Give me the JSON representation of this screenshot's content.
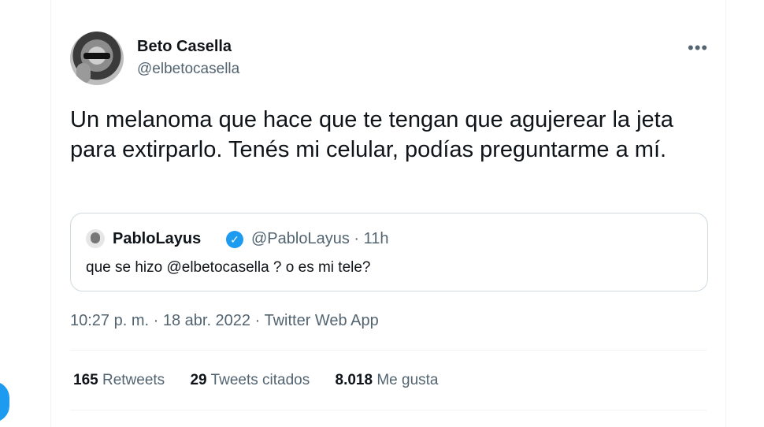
{
  "author": {
    "name": "Beto Casella",
    "handle": "@elbetocasella"
  },
  "tweet": {
    "text": "Un melanoma que hace que te tengan que agujerear la jeta para extirparlo. Tenés mi celular, podías preguntarme a mí.",
    "timestamp": "10:27 p. m. · 18 abr. 2022 · Twitter Web App"
  },
  "quoted": {
    "name": "PabloLayus",
    "meta": "@PabloLayus · 11h",
    "text": "que se hizo @elbetocasella ? o es mi tele?"
  },
  "stats": {
    "retweets_count": "165",
    "retweets_label": "Retweets",
    "quotes_count": "29",
    "quotes_label": "Tweets citados",
    "likes_count": "8.018",
    "likes_label": "Me gusta"
  },
  "icons": {
    "more": "more-horizontal-icon",
    "verified": "verified-badge-icon"
  },
  "colors": {
    "accent": "#1d9bf0",
    "secondary_text": "#536471",
    "border": "#cfd9de"
  }
}
